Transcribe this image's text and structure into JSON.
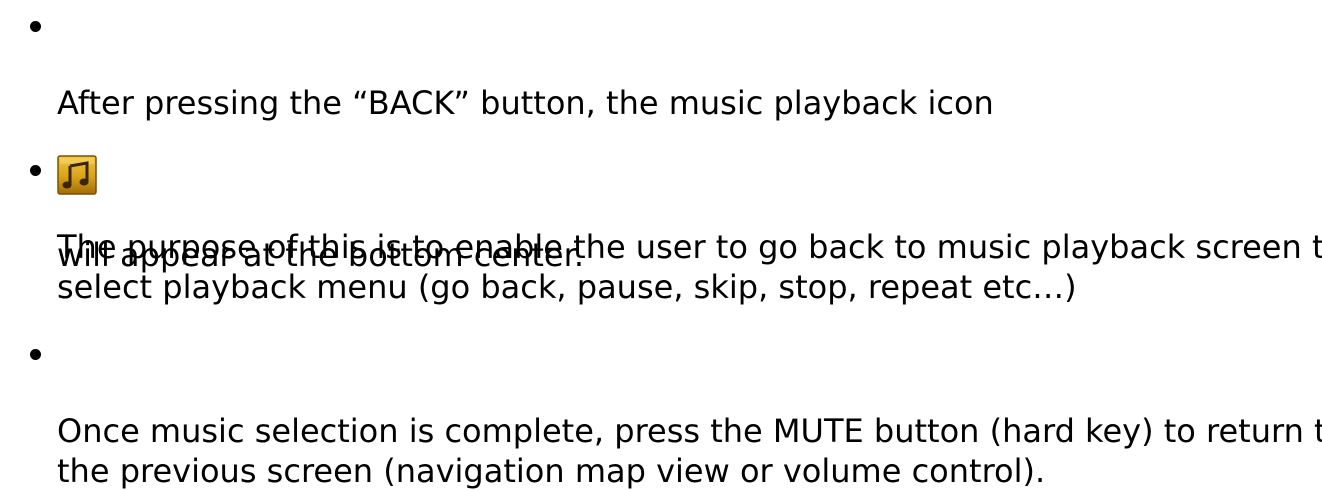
{
  "bullets": [
    {
      "text_before_icon": "After pressing the “BACK” button, the music playback icon",
      "icon": "music-playback-icon",
      "text_after_icon": " will appear at the bottom center."
    },
    {
      "text": "The purpose of this is to enable the user to go back to music playback screen to select playback menu (go back, pause, skip, stop, repeat etc…)"
    },
    {
      "text": "Once music selection is complete, press the MUTE button (hard key) to return to the previous screen (navigation map view or volume control)."
    }
  ],
  "colors": {
    "icon_gold": "#d9a21a",
    "icon_dark": "#5a3a08"
  }
}
